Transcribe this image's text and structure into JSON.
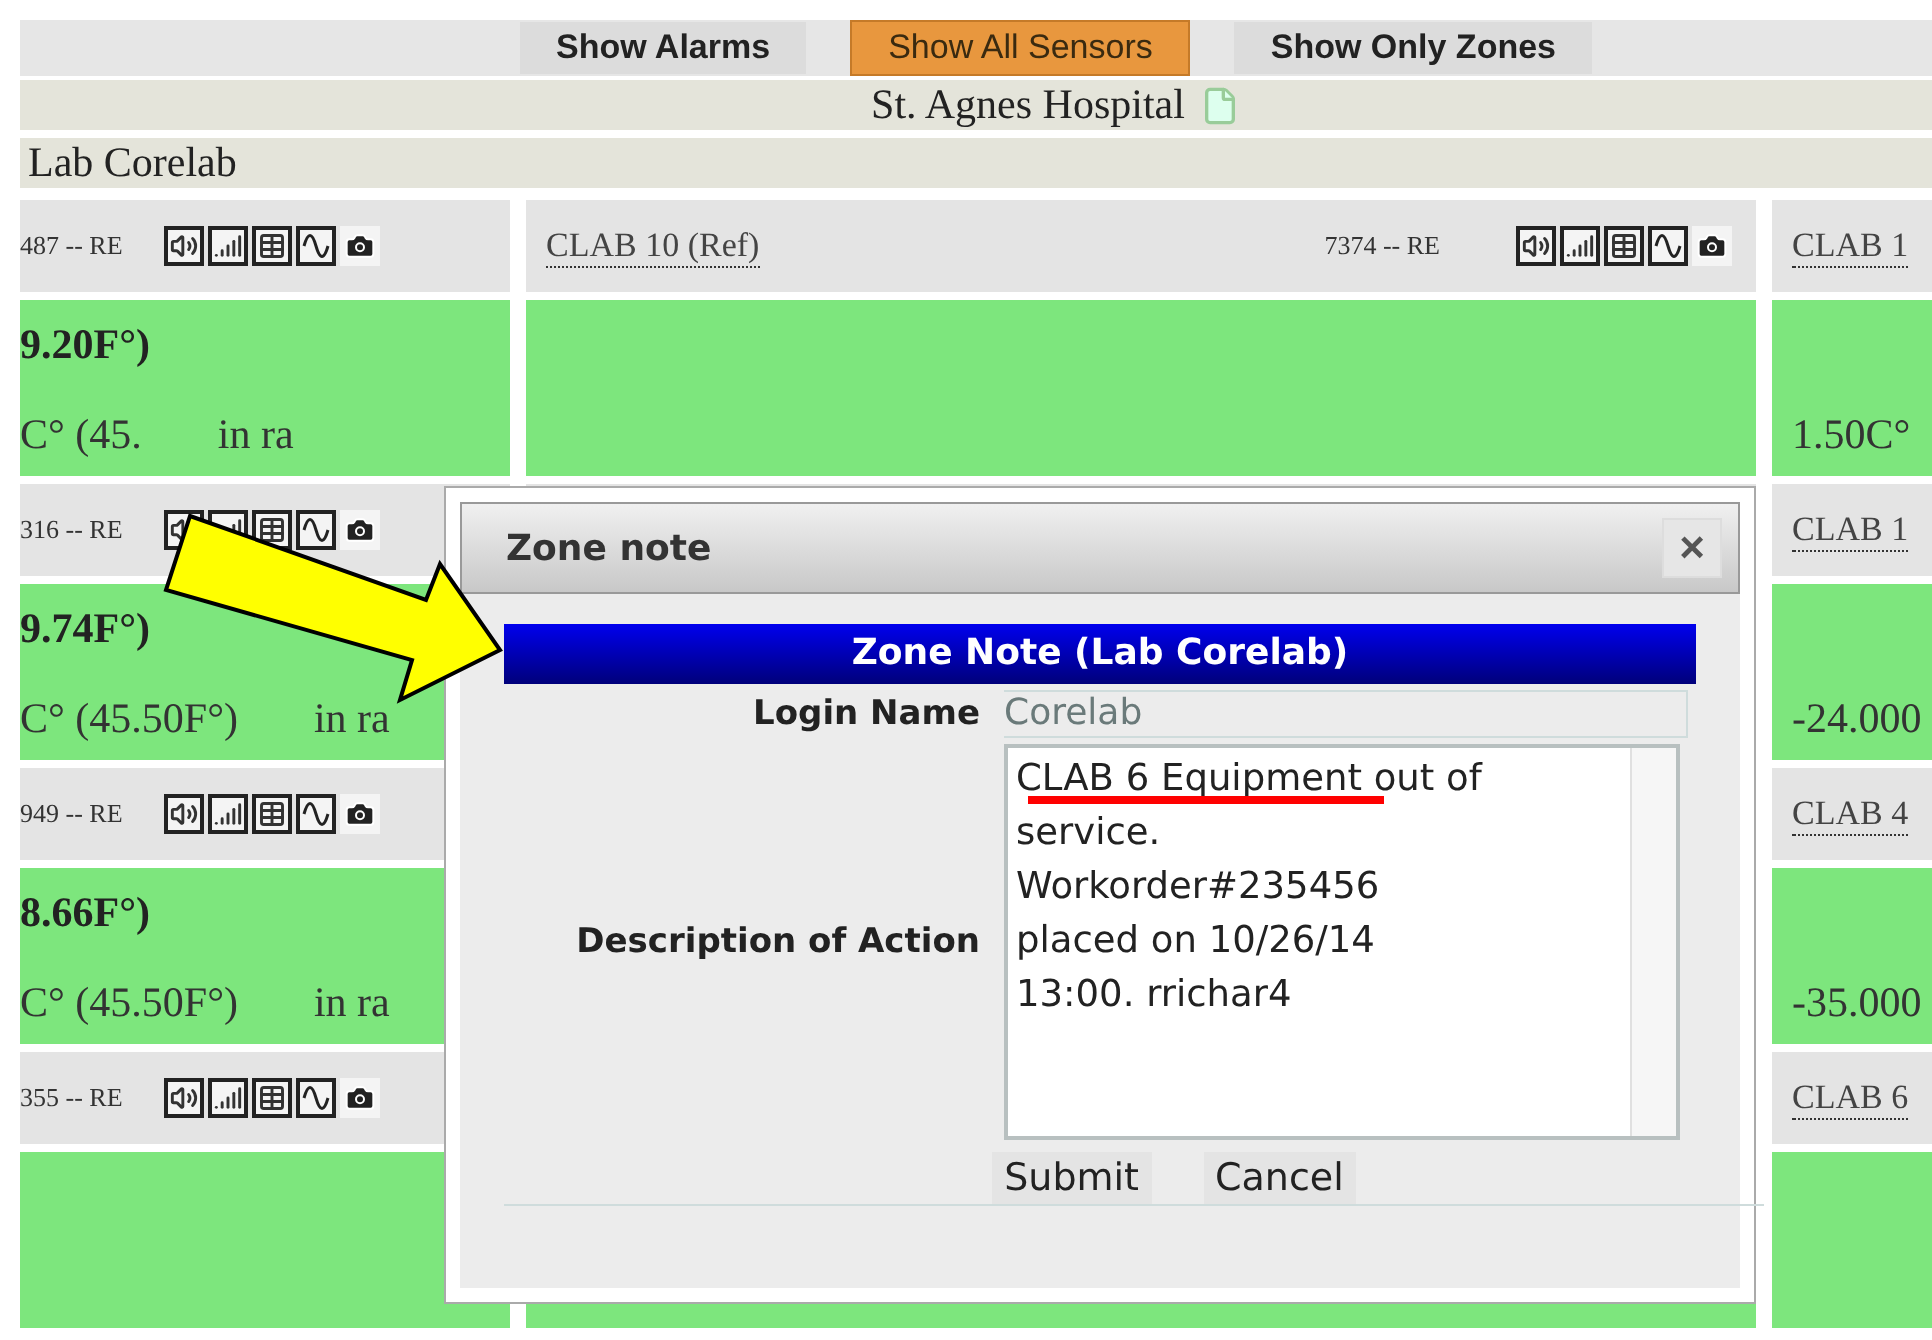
{
  "toolbar": {
    "buttons": [
      {
        "label": "Show Alarms",
        "selected": false
      },
      {
        "label": "Show All Sensors",
        "selected": true
      },
      {
        "label": "Show Only Zones",
        "selected": false
      }
    ]
  },
  "facility": {
    "name": "St. Agnes Hospital"
  },
  "zone": {
    "name": "Lab Corelab"
  },
  "sensor_rows": [
    {
      "column_1": {
        "id": "487 -- RE",
        "reading_f": "9.20F°)",
        "reading_c": "C° (45.",
        "status": "in ra"
      },
      "column_2": {
        "name": "CLAB 10 (Ref)",
        "id": "7374 -- RE"
      },
      "column_3": {
        "name": "CLAB 1",
        "reading": "1.50C°"
      }
    },
    {
      "column_1": {
        "id": "316 -- RE",
        "reading_f": "9.74F°)",
        "reading_c": "C° (45.50F°)",
        "status": "in ra"
      },
      "column_3": {
        "name": "CLAB 1",
        "reading": "-24.000"
      }
    },
    {
      "column_1": {
        "id": "949 -- RE",
        "reading_f": "8.66F°)",
        "reading_c": "C° (45.50F°)",
        "status": "in ra"
      },
      "column_3": {
        "name": "CLAB 4",
        "reading": "-35.000"
      }
    },
    {
      "column_1": {
        "id": "355 -- RE"
      },
      "column_3": {
        "name": "CLAB 6"
      }
    }
  ],
  "dialog": {
    "title": "Zone note",
    "close": "×",
    "header": "Zone Note (Lab Corelab)",
    "fields": [
      {
        "kind": "text",
        "label": "Login Name",
        "value": "Corelab"
      },
      {
        "kind": "textarea",
        "label": "Description of Action",
        "value": "CLAB 6 Equipment out of service.\nWorkorder#235456\nplaced on 10/26/14\n13:00. rrichar4"
      }
    ],
    "buttons": [
      "Submit",
      "Cancel"
    ]
  }
}
